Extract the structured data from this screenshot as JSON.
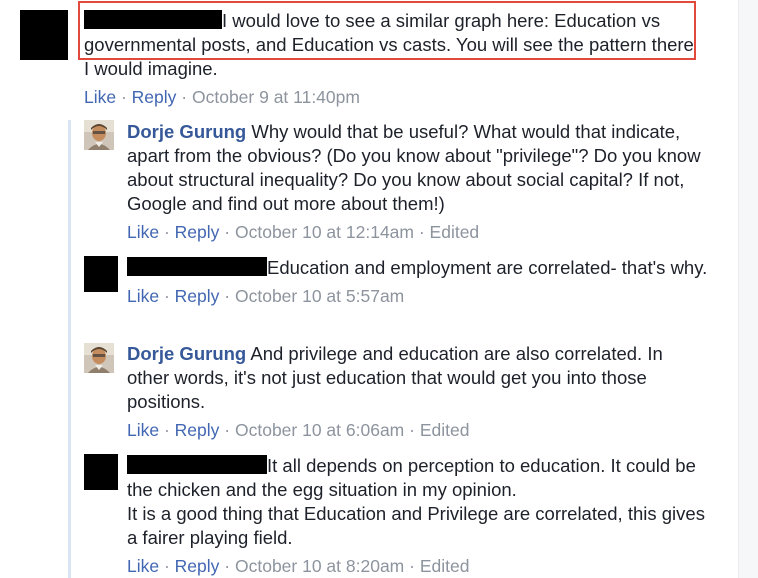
{
  "comments": [
    {
      "text_line1": "I would love to see a similar graph here: Education vs",
      "text_rest": "governmental posts, and Education vs casts. You will see the pattern there I would imagine.",
      "like": "Like",
      "reply": "Reply",
      "timestamp": "October 9 at 11:40pm"
    },
    {
      "author": "Dorje Gurung",
      "text": "Why would that be useful? What would that indicate, apart from the obvious? (Do you know about \"privilege\"? Do you know about structural inequality? Do you know about social capital? If not, Google and find out more about them!)",
      "like": "Like",
      "reply": "Reply",
      "timestamp": "October 10 at 12:14am",
      "edited": "Edited"
    },
    {
      "text_line1": "Education and employment are correlated- that's",
      "text_rest": "why.",
      "like": "Like",
      "reply": "Reply",
      "timestamp": "October 10 at 5:57am"
    },
    {
      "author": "Dorje Gurung",
      "text": "And privilege and education are also correlated. In other words, it's not just education that would get you into those positions.",
      "like": "Like",
      "reply": "Reply",
      "timestamp": "October 10 at 6:06am",
      "edited": "Edited"
    },
    {
      "text_line1": "It all depends on perception to education. It could be",
      "text_line2": "the chicken and the egg situation in my opinion.",
      "text_para2": "It is a good thing that Education and Privilege are correlated, this gives a fairer playing field.",
      "like": "Like",
      "reply": "Reply",
      "timestamp": "October 10 at 8:20am",
      "edited": "Edited"
    }
  ],
  "separator": " · ",
  "colors": {
    "author": "#365899",
    "link": "#4267b2",
    "meta": "#8d949e",
    "highlight": "#e0493b",
    "redaction": "#000000"
  },
  "icons": {
    "avatar": "profile-photo-icon",
    "redacted_avatar": "redacted-avatar"
  }
}
